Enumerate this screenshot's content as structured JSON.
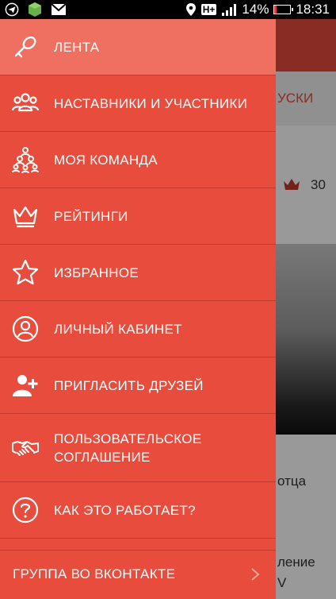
{
  "status_bar": {
    "battery": "14%",
    "time": "18:31",
    "network": "H+"
  },
  "background": {
    "tab_partial": "УСКИ",
    "rating_count": "30",
    "text_lines": [
      "отца",
      "ление",
      "V"
    ]
  },
  "menu": {
    "items": [
      {
        "label": "ЛЕНТА",
        "icon": "microphone-icon",
        "active": true
      },
      {
        "label": "НАСТАВНИКИ И УЧАСТНИКИ",
        "icon": "group-icon"
      },
      {
        "label": "МОЯ КОМАНДА",
        "icon": "team-icon"
      },
      {
        "label": "РЕЙТИНГИ",
        "icon": "crown-icon"
      },
      {
        "label": "ИЗБРАННОЕ",
        "icon": "star-icon"
      },
      {
        "label": "ЛИЧНЫЙ КАБИНЕТ",
        "icon": "user-circle-icon"
      },
      {
        "label": "ПРИГЛАСИТЬ ДРУЗЕЙ",
        "icon": "add-user-icon"
      },
      {
        "label": "ПОЛЬЗОВАТЕЛЬСКОЕ\nСОГЛАШЕНИЕ",
        "icon": "handshake-icon"
      },
      {
        "label": "КАК ЭТО РАБОТАЕТ?",
        "icon": "question-icon"
      }
    ],
    "footer_label": "ГРУППА ВО ВКОНТАКТЕ"
  },
  "colors": {
    "drawer": "#e74c3c",
    "active": "#ef6f61",
    "divider": "#c33a2c"
  }
}
